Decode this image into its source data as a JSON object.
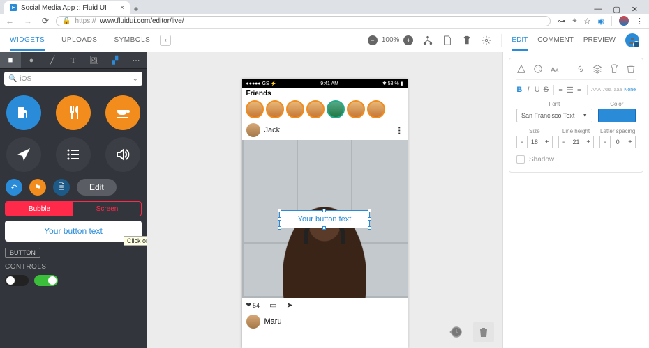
{
  "browser": {
    "tab_title": "Social Media App :: Fluid UI",
    "favicon_letter": "F",
    "url_prefix": "https://",
    "url": "www.fluidui.com/editor/live/"
  },
  "appbar": {
    "tabs": {
      "widgets": "WIDGETS",
      "uploads": "UPLOADS",
      "symbols": "SYMBOLS"
    },
    "zoom": "100%",
    "modes": {
      "edit": "EDIT",
      "comment": "COMMENT",
      "preview": "PREVIEW"
    }
  },
  "sidebar": {
    "search_placeholder": "iOS",
    "edit_label": "Edit",
    "variants": {
      "bubble": "Bubble",
      "screen": "Screen"
    },
    "preview_button_text": "Your button text",
    "tooltip": "Click or drag-and-drop to add",
    "widget_tag": "BUTTON",
    "controls_header": "CONTROLS"
  },
  "phone": {
    "status": {
      "left": "●●●●● GS ⚡",
      "time": "9:41 AM",
      "right": "✱ 58 % ▮"
    },
    "friends_label": "Friends",
    "post_author": "Jack",
    "selected_button_text": "Your button text",
    "likes": "54",
    "next_author": "Maru"
  },
  "inspector": {
    "font_label": "Font",
    "color_label": "Color",
    "font_value": "San Francisco Text",
    "size_label": "Size",
    "size_value": "18",
    "line_height_label": "Line height",
    "line_height_value": "21",
    "letter_spacing_label": "Letter spacing",
    "letter_spacing_value": "0",
    "cases": {
      "caps": "AAA",
      "title": "Aaa",
      "lower": "aaa",
      "none": "None"
    },
    "shadow_label": "Shadow"
  }
}
